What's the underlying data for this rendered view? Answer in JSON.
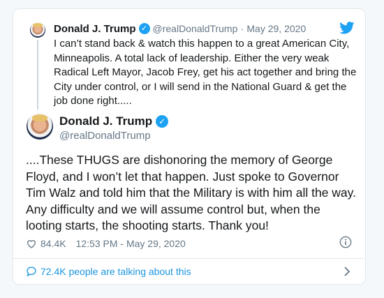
{
  "quoted": {
    "name": "Donald J. Trump",
    "handle": "@realDonaldTrump",
    "separator": "·",
    "date": "May 29, 2020",
    "text": "I can’t stand back & watch this happen to a great American City, Minneapolis. A total lack of leadership. Either the very weak Radical Left Mayor, Jacob Frey, get his act together and bring the City under control, or I will send in the National Guard & get the job done right....."
  },
  "main": {
    "name": "Donald J. Trump",
    "handle": "@realDonaldTrump",
    "text": "....These THUGS are dishonoring the memory of George Floyd, and I won’t let that happen. Just spoke to Governor Tim Walz and told him that the Military is with him all the way. Any difficulty and we will assume control but, when the looting starts, the shooting starts. Thank you!",
    "likes": "84.4K",
    "timestamp": "12:53 PM - May 29, 2020"
  },
  "footer": {
    "talking": "72.4K people are talking about this"
  },
  "icons": {
    "verified": "✓",
    "brand_color": "#1da1f2",
    "link_color": "#1b95e0"
  }
}
